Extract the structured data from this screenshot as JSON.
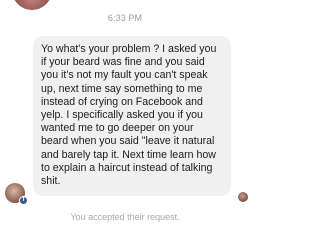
{
  "conversation": {
    "timestamp": "6:33 PM",
    "message": {
      "text": "Yo what's your problem ? I asked you if your beard was fine and you said you it's not my fault you can't speak up, next time say something to me instead of crying on Facebook and yelp. I specifically asked you if you wanted me to go deeper on your beard when you said \"leave it natural and barely tap it. Next time learn how to explain a haircut instead of talking shit."
    },
    "status_text": "You accepted their request.",
    "sender_badge_glyph": "f"
  },
  "colors": {
    "bubble_background": "#f0f0f0",
    "message_text": "#1c1c1c",
    "timestamp_text": "#9b9b9b",
    "status_text": "#a8a8a8",
    "facebook_badge": "#3b5998"
  },
  "icons": {
    "sender_badge": "facebook-badge-icon"
  }
}
